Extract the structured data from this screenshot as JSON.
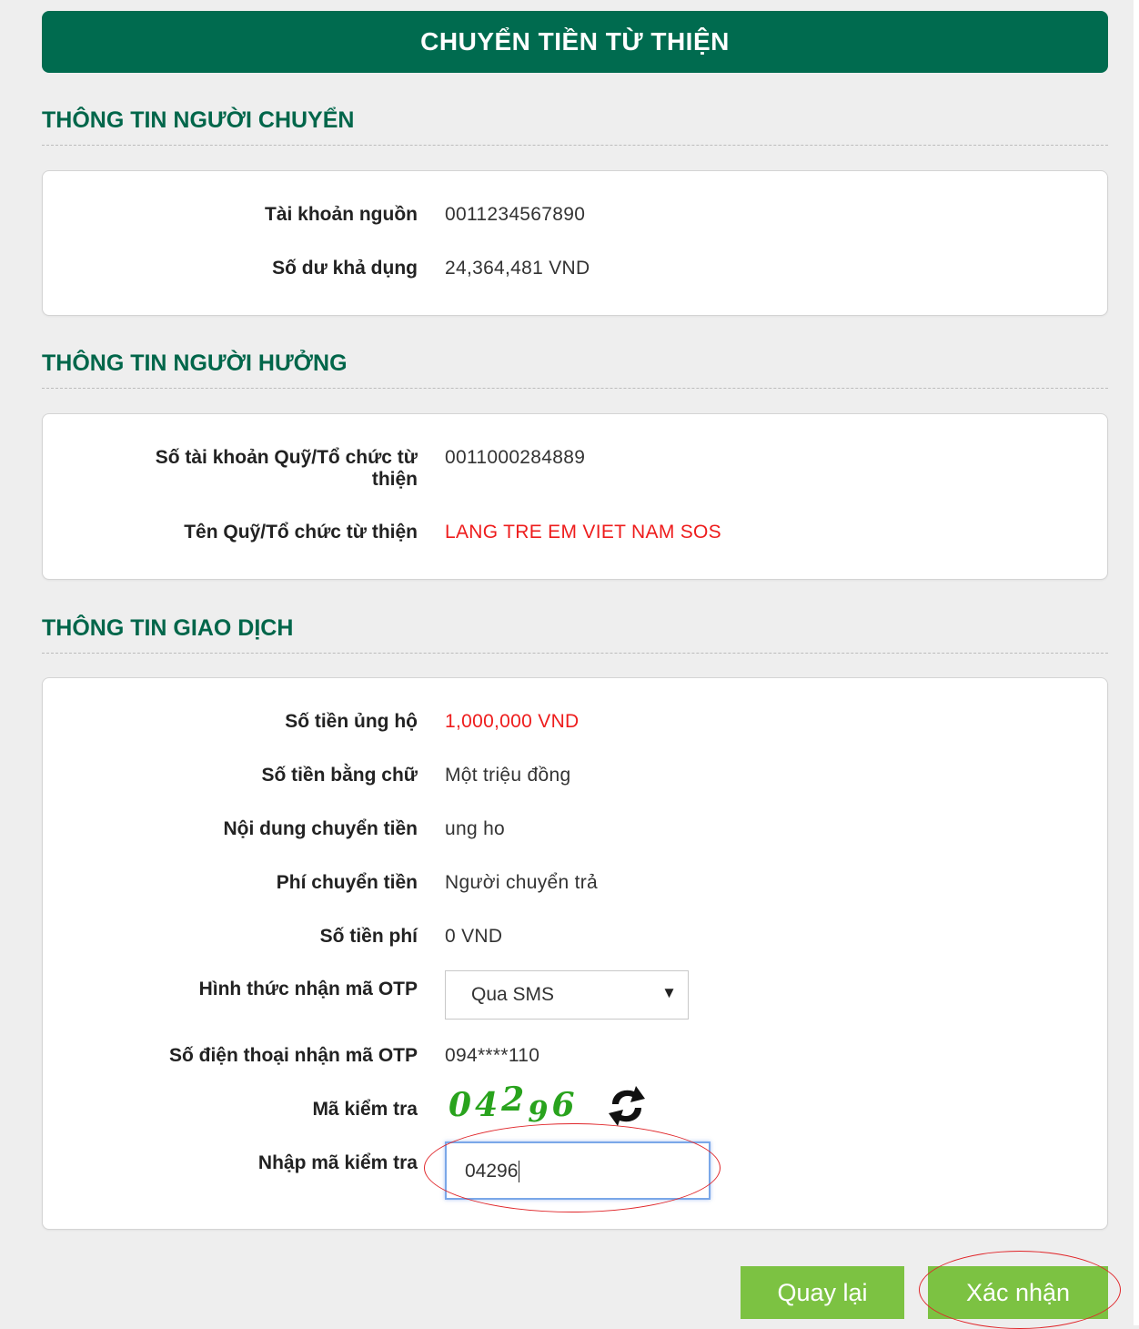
{
  "header": {
    "title": "CHUYỂN TIỀN TỪ THIỆN"
  },
  "sender": {
    "title": "THÔNG TIN NGƯỜI CHUYỂN",
    "rows": [
      {
        "label": "Tài khoản nguồn",
        "value": "0011234567890"
      },
      {
        "label": "Số dư khả dụng",
        "value": "24,364,481 VND"
      }
    ]
  },
  "beneficiary": {
    "title": "THÔNG TIN NGƯỜI HƯỞNG",
    "rows": [
      {
        "label_line1": "Số tài khoản Quỹ/Tổ chức từ",
        "label_line2": "thiện",
        "value": "0011000284889"
      },
      {
        "label": "Tên Quỹ/Tổ chức từ thiện",
        "value": "LANG TRE EM VIET NAM SOS"
      }
    ]
  },
  "transaction": {
    "title": "THÔNG TIN GIAO DỊCH",
    "rows": [
      {
        "label": "Số tiền ủng hộ",
        "value": "1,000,000 VND"
      },
      {
        "label": "Số tiền bằng chữ",
        "value": "Một triệu đồng"
      },
      {
        "label": "Nội dung chuyển tiền",
        "value": "ung ho"
      },
      {
        "label": "Phí chuyển tiền",
        "value": "Người chuyển trả"
      },
      {
        "label": "Số tiền phí",
        "value": "0 VND"
      }
    ],
    "otp_method": {
      "label": "Hình thức nhận mã OTP",
      "selected": "Qua SMS",
      "arrow": "▼"
    },
    "otp_phone": {
      "label": "Số điện thoại nhận mã OTP",
      "value": "094****110"
    },
    "captcha": {
      "label": "Mã kiểm tra",
      "digits": [
        "0",
        "4",
        "2",
        "9",
        "6"
      ],
      "refresh_icon": "refresh-icon"
    },
    "captcha_input": {
      "label": "Nhập mã kiểm tra",
      "value": "04296"
    }
  },
  "actions": {
    "back_label": "Quay lại",
    "confirm_label": "Xác nhận"
  },
  "colors": {
    "header": "#006b4f",
    "title": "#00664a",
    "button": "#7cc242",
    "highlight": "#ee1c1c",
    "annotation": "#e0262a"
  }
}
